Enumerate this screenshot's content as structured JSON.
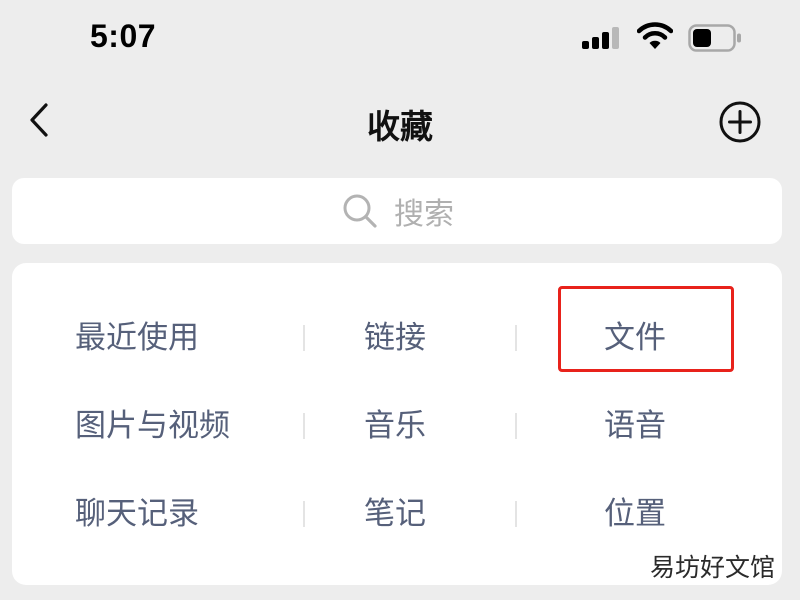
{
  "status_bar": {
    "time": "5:07",
    "icons": [
      "cellular-signal-icon",
      "wifi-icon",
      "battery-icon"
    ]
  },
  "nav": {
    "title": "收藏",
    "back_icon": "chevron-left-icon",
    "add_icon": "plus-circle-icon"
  },
  "search": {
    "icon": "search-icon",
    "placeholder": "搜索"
  },
  "categories": {
    "items": [
      {
        "label": "最近使用",
        "highlighted": false
      },
      {
        "label": "链接",
        "highlighted": false
      },
      {
        "label": "文件",
        "highlighted": true
      },
      {
        "label": "图片与视频",
        "highlighted": false
      },
      {
        "label": "音乐",
        "highlighted": false
      },
      {
        "label": "语音",
        "highlighted": false
      },
      {
        "label": "聊天记录",
        "highlighted": false
      },
      {
        "label": "笔记",
        "highlighted": false
      },
      {
        "label": "位置",
        "highlighted": false
      }
    ]
  },
  "watermark": "易坊好文馆",
  "colors": {
    "background": "#ededed",
    "card": "#ffffff",
    "category_text": "#56607a",
    "highlight": "#e8221b",
    "placeholder": "#b0b0b0"
  }
}
